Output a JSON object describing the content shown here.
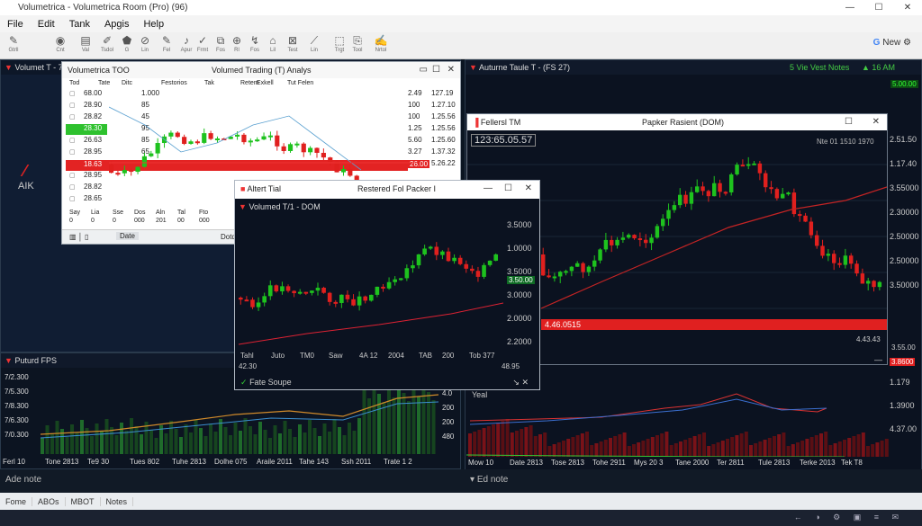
{
  "title": "Volumetrica - Volumetrica Room (Pro) (96)",
  "window_buttons": [
    "—",
    "☐",
    "✕"
  ],
  "menu": [
    "File",
    "Edit",
    "Tank",
    "Apgis",
    "Help"
  ],
  "toolbar": [
    {
      "icon": "wrench-icon",
      "label": "Gtrll"
    },
    {
      "icon": "chrome-icon",
      "label": "Cnt"
    },
    {
      "icon": "chart-icon",
      "label": "Val"
    },
    {
      "icon": "draw-icon",
      "label": "Tsdol"
    },
    {
      "icon": "paint-icon",
      "label": "G"
    },
    {
      "icon": "link-icon",
      "label": "Lin"
    },
    {
      "icon": "pen-icon",
      "label": "Fel"
    },
    {
      "icon": "music-icon",
      "label": "Apur"
    },
    {
      "icon": "check-icon",
      "label": "Frmt"
    },
    {
      "icon": "copy-icon",
      "label": "Fos"
    },
    {
      "icon": "target-icon",
      "label": "Rl"
    },
    {
      "icon": "bolt-icon",
      "label": "Fos"
    },
    {
      "icon": "tag-icon",
      "label": "Lil"
    },
    {
      "icon": "close-box-icon",
      "label": "Test"
    },
    {
      "icon": "brush-icon",
      "label": "Lin"
    },
    {
      "icon": "select-icon",
      "label": "Trgt"
    },
    {
      "icon": "clip-icon",
      "label": "Tool"
    },
    {
      "icon": "edit-icon",
      "label": "Nrtol"
    }
  ],
  "new_label": "New",
  "side_logo": "AIK",
  "left_panel": {
    "title": "Volumet T - 70"
  },
  "dom_window": {
    "title": "Volumetrica TOO",
    "center_title": "Volumed Trading (T) Analys",
    "headers": [
      "Tod",
      "Tate",
      "Ditc",
      "Festorios",
      "Tak",
      "Retem",
      "Exkell",
      "Tut Felen"
    ],
    "side_rows": [
      "68.00",
      "28.90",
      "28.82",
      "28.90",
      "26.63",
      "28.95",
      "18.63",
      "28.95",
      "28.82",
      "28.65"
    ],
    "col2": [
      "1.000",
      "85",
      "45",
      "95",
      "85",
      "65",
      "55",
      "",
      "",
      ""
    ],
    "right_a": [
      "2.49",
      "100",
      "100",
      "1.25",
      "5.60",
      "3.27",
      "3.29",
      "",
      "",
      ""
    ],
    "right_b": [
      "127.19",
      "1.27.10",
      "1.25.56",
      "1.25.56",
      "1.25.60",
      "1.37.32",
      "5.26.22",
      "",
      "",
      ""
    ],
    "hilite_green": "28.30",
    "hilite_red": "18.63",
    "red_price": "26.00",
    "bottom_row": [
      "Say",
      "Lia",
      "Sse",
      "Dos",
      "Aln",
      "Tal",
      "Fto"
    ],
    "bottom_row2": [
      "0",
      "0",
      "0",
      "000",
      "201",
      "00",
      "000"
    ],
    "footer": [
      "Date",
      "Dotd"
    ]
  },
  "small_window": {
    "title": "Altert Tial",
    "center_title": "Restered Fol Packer I",
    "sub_title": "Volumed T/1 - DOM",
    "y_ticks": [
      "3.5000",
      "1.0000",
      "3.5000",
      "3.0000",
      "2.0000",
      "2.2000"
    ],
    "current": "3.50.00",
    "x_ticks": [
      "Tahl",
      "Juto",
      "TM0",
      "Saw",
      "4A 12",
      "2004",
      "TAB",
      "200",
      "Tob 377"
    ],
    "x_extra": "42.30",
    "x_right": "48.95",
    "footer": "Fate Soupe"
  },
  "right_panel": {
    "title": "Auturne Taule T - (FS 27)",
    "top_right": "5 Vie Vest Notes",
    "top_right2": "16 AM",
    "top_tag": "5.00.00"
  },
  "big_window": {
    "title": "Fellersl TM",
    "center_title": "Papker Rasient (DOM)",
    "price_box": "123:65.05.57",
    "top_right": "Nte 01 1510 1970",
    "y_ticks": [
      "2.51.50",
      "1.17.40",
      "3.55000",
      "2.30000",
      "2.50000",
      "2.50000",
      "3.50000"
    ],
    "redbar": "4.46.0515",
    "low_right": "4.43.43"
  },
  "bottom_left": {
    "title": "Puturd FPS",
    "y_ticks": [
      "7/2.300",
      "7/5.300",
      "7/8.300",
      "7/6.300",
      "7/0.300"
    ],
    "right_ticks": [
      "4.0",
      "200",
      "200",
      "480"
    ],
    "x_ticks": [
      "Ferl 10",
      "Tone 2813",
      "Te9 30",
      "Tues 802",
      "Tuhe 2813",
      "Dolhe 075",
      "Araile 2011",
      "Tahe 143",
      "Ssh 2011",
      "Trate 1 2"
    ]
  },
  "bottom_right": {
    "title": "Yeal",
    "x_ticks": [
      "Mow 10",
      "Date 2813",
      "Tose 2813",
      "Tohe 2911",
      "Mys 20 3",
      "Tane 2000",
      "Ter 2811",
      "Tule 2813",
      "Terke 2013",
      "Tek T8"
    ],
    "right_ticks": [
      "1.179",
      "1.3900",
      "4.37.00"
    ],
    "badge_red": "3.8600",
    "badge_low": "3.55.00"
  },
  "tabs_left": "Ade note",
  "tabs_right": "Ed note",
  "status": [
    "Fome",
    "ABOs",
    "MBOT",
    "Notes"
  ],
  "tray": "← ◑ ⚙ ▣ ≡ ✉",
  "colors": {
    "up": "#1ec21e",
    "down": "#e0201e",
    "ma": "#d4282a",
    "bg": "#0b1220"
  }
}
